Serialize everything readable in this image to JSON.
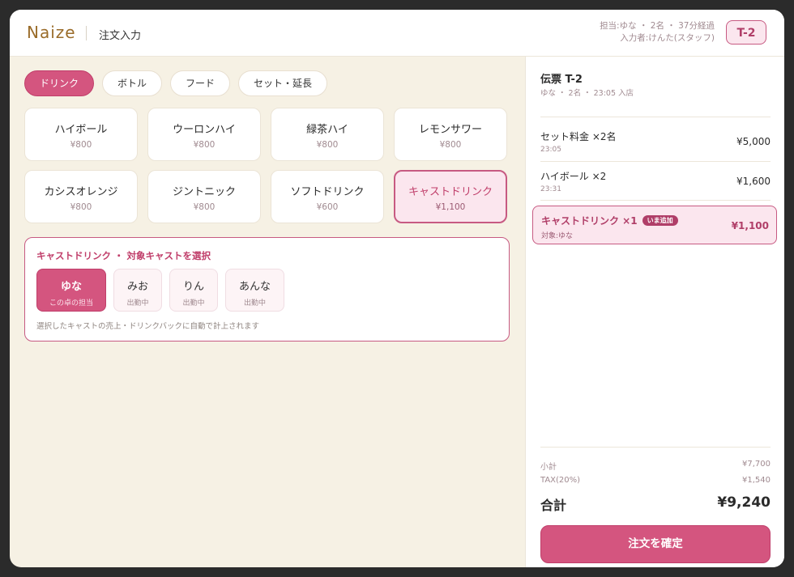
{
  "header": {
    "brand": "Naize",
    "screen_title": "注文入力",
    "info_line1": "担当:ゆな ・ 2名 ・ 37分経過",
    "info_line2": "入力者:けんた(スタッフ)",
    "table_badge": "T-2"
  },
  "tabs": [
    {
      "label": "ドリンク",
      "active": true
    },
    {
      "label": "ボトル",
      "active": false
    },
    {
      "label": "フード",
      "active": false
    },
    {
      "label": "セット・延長",
      "active": false
    }
  ],
  "menu_items": [
    {
      "name": "ハイボール",
      "price": "¥800"
    },
    {
      "name": "ウーロンハイ",
      "price": "¥800"
    },
    {
      "name": "緑茶ハイ",
      "price": "¥800"
    },
    {
      "name": "レモンサワー",
      "price": "¥800"
    },
    {
      "name": "カシスオレンジ",
      "price": "¥800"
    },
    {
      "name": "ジントニック",
      "price": "¥800"
    },
    {
      "name": "ソフトドリンク",
      "price": "¥600"
    },
    {
      "name": "キャストドリンク",
      "price": "¥1,100",
      "selected": true
    }
  ],
  "cast_select": {
    "title": "キャストドリンク ・ 対象キャストを選択",
    "casts": [
      {
        "name": "ゆな",
        "status": "この卓の担当",
        "active": true
      },
      {
        "name": "みお",
        "status": "出勤中"
      },
      {
        "name": "りん",
        "status": "出勤中"
      },
      {
        "name": "あんな",
        "status": "出勤中"
      }
    ],
    "note": "選択したキャストの売上・ドリンクバックに自動で計上されます"
  },
  "slip": {
    "title": "伝票 T-2",
    "subtitle": "ゆな ・ 2名 ・ 23:05 入店",
    "items": [
      {
        "name": "セット料金 ×2名",
        "time": "23:05",
        "price": "¥5,000"
      },
      {
        "name": "ハイボール ×2",
        "time": "23:31",
        "price": "¥1,600"
      }
    ],
    "added_item": {
      "name": "キャストドリンク ×1",
      "badge": "いま追加",
      "target": "対象:ゆな",
      "price": "¥1,100"
    },
    "subtotal_label": "小計",
    "subtotal": "¥7,700",
    "tax_label": "TAX(20%)",
    "tax": "¥1,540",
    "total_label": "合計",
    "total": "¥9,240",
    "confirm_label": "注文を確定"
  }
}
